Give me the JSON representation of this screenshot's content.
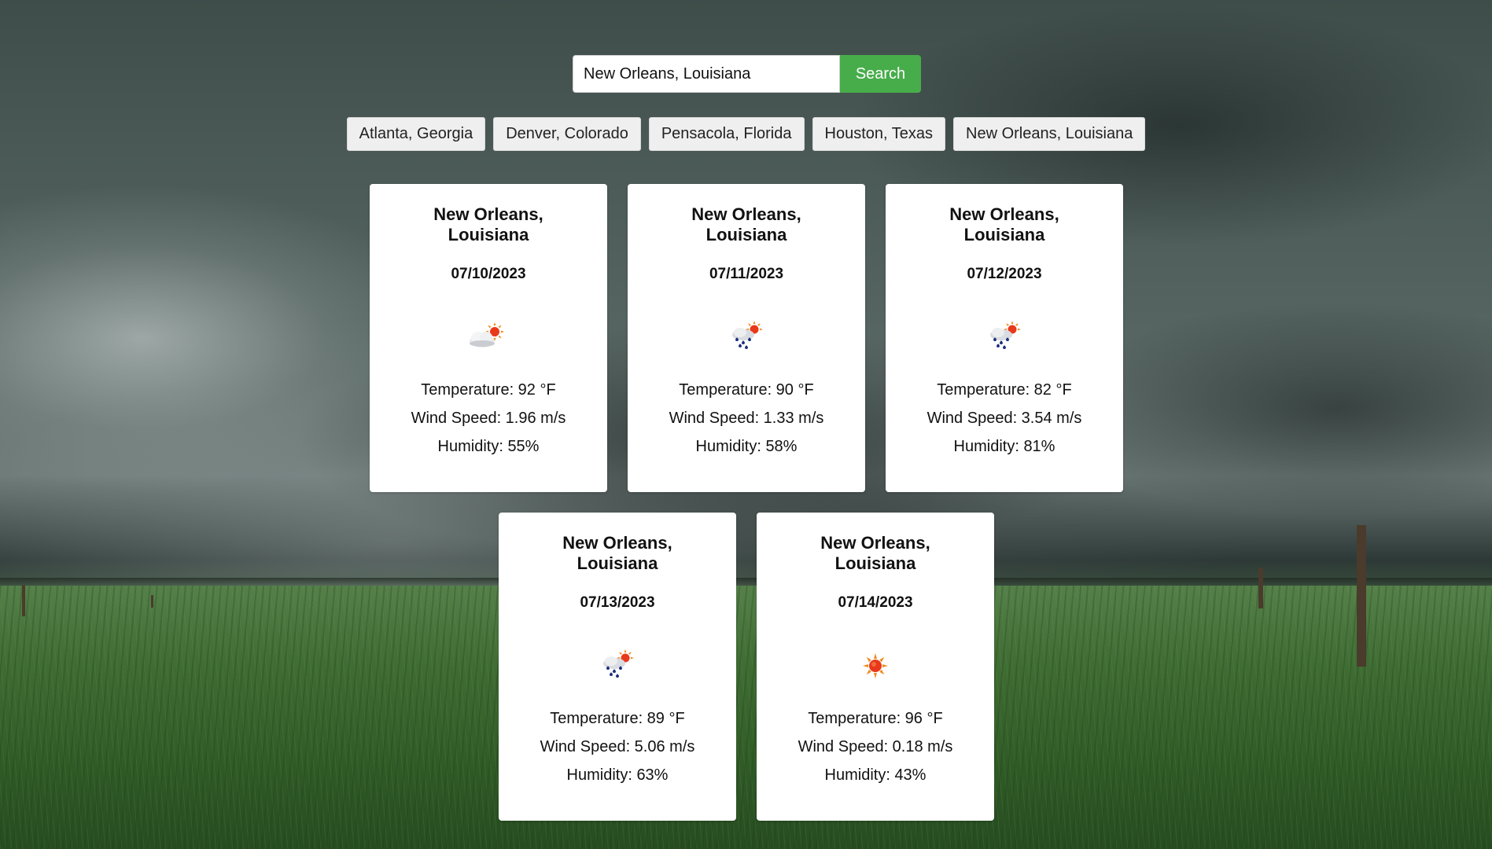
{
  "search": {
    "value": "New Orleans, Louisiana",
    "button_label": "Search"
  },
  "history": [
    "Atlanta, Georgia",
    "Denver, Colorado",
    "Pensacola, Florida",
    "Houston, Texas",
    "New Orleans, Louisiana"
  ],
  "forecast": [
    {
      "city": "New Orleans, Louisiana",
      "date": "07/10/2023",
      "icon": "partly-cloudy-sun-icon",
      "temperature": "Temperature: 92 °F",
      "wind": "Wind Speed: 1.96 m/s",
      "humidity": "Humidity: 55%"
    },
    {
      "city": "New Orleans, Louisiana",
      "date": "07/11/2023",
      "icon": "rain-sun-icon",
      "temperature": "Temperature: 90 °F",
      "wind": "Wind Speed: 1.33 m/s",
      "humidity": "Humidity: 58%"
    },
    {
      "city": "New Orleans, Louisiana",
      "date": "07/12/2023",
      "icon": "rain-sun-icon",
      "temperature": "Temperature: 82 °F",
      "wind": "Wind Speed: 3.54 m/s",
      "humidity": "Humidity: 81%"
    },
    {
      "city": "New Orleans, Louisiana",
      "date": "07/13/2023",
      "icon": "rain-sun-icon",
      "temperature": "Temperature: 89 °F",
      "wind": "Wind Speed: 5.06 m/s",
      "humidity": "Humidity: 63%"
    },
    {
      "city": "New Orleans, Louisiana",
      "date": "07/14/2023",
      "icon": "sun-icon",
      "temperature": "Temperature: 96 °F",
      "wind": "Wind Speed: 0.18 m/s",
      "humidity": "Humidity: 43%"
    }
  ],
  "colors": {
    "search_button": "#47ad4b",
    "card_background": "#ffffff"
  }
}
